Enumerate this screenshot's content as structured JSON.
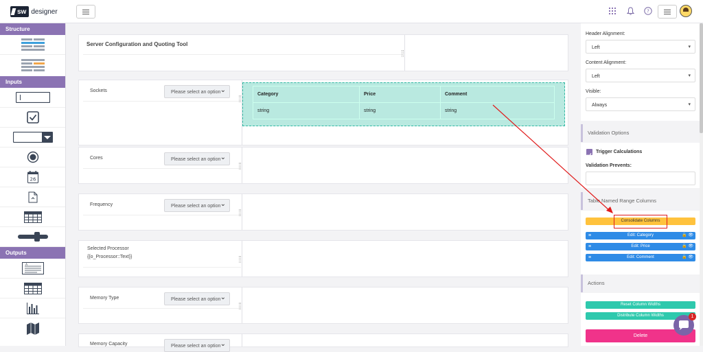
{
  "app": {
    "logo_badge": "sw",
    "logo_text": "designer"
  },
  "sidebar": {
    "structure_label": "Structure",
    "inputs_label": "Inputs",
    "outputs_label": "Outputs",
    "date_icon_number": "26"
  },
  "canvas": {
    "title": "Server Configuration and Quoting Tool",
    "rows": [
      {
        "label": "Sockets",
        "placeholder": "Please select an option"
      },
      {
        "label": "Cores",
        "placeholder": "Please select an option"
      },
      {
        "label": "Frequency",
        "placeholder": "Please select an option"
      },
      {
        "label": "Memory Type",
        "placeholder": "Please select an option"
      },
      {
        "label": "Memory Capacity",
        "placeholder": "Please select an option"
      }
    ],
    "processor_label": "Selected Processor",
    "processor_value": "{{o_Processor::Text}}",
    "table": {
      "headers": [
        "Category",
        "Price",
        "Comment"
      ],
      "row": [
        "string",
        "string",
        "string"
      ]
    }
  },
  "right_panel": {
    "header_alignment_label": "Header Alignment:",
    "header_alignment_value": "Left",
    "content_alignment_label": "Content Alignment:",
    "content_alignment_value": "Left",
    "visible_label": "Visible:",
    "visible_value": "Always",
    "validation_section": "Validation Options",
    "trigger_calculations": "Trigger Calculations",
    "validation_prevents": "Validation Prevents:",
    "named_range_section": "Table Named Range Columns",
    "consolidate": "Consolidate Columns",
    "edit_columns": [
      "Edit: Category",
      "Edit: Price",
      "Edit: Comment"
    ],
    "actions_section": "Actions",
    "reset_widths": "Reset Column Widths",
    "distribute_widths": "Distribute Column Widths",
    "delete": "Delete"
  },
  "chat": {
    "badge": "1"
  },
  "colors": {
    "accent": "#8b73b3",
    "teal": "#2fb7a2",
    "edit_blue": "#2e8be6",
    "consolidate_yellow": "#ffc23d",
    "delete_pink": "#f0338a",
    "annotation_red": "#e01b1b"
  }
}
